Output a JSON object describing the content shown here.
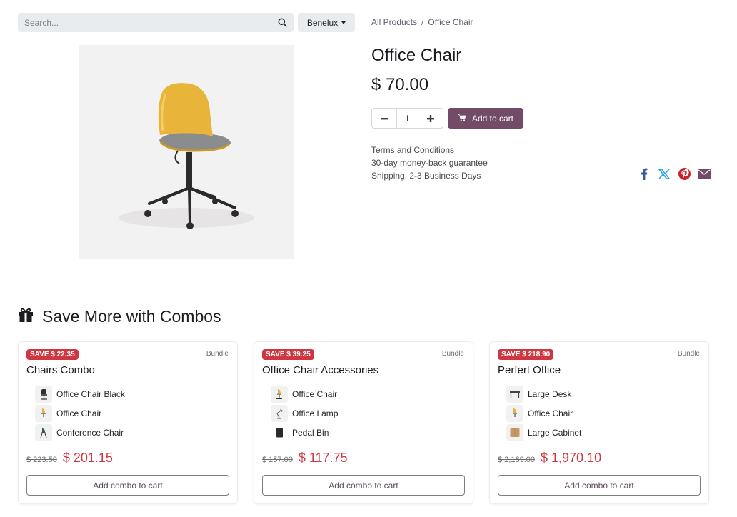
{
  "search": {
    "placeholder": "Search..."
  },
  "pricelist": {
    "label": "Benelux"
  },
  "breadcrumb": {
    "all_products": "All Products",
    "separator": "/",
    "current": "Office Chair"
  },
  "product": {
    "title": "Office Chair",
    "price": "$ 70.00",
    "quantity": "1",
    "add_to_cart": "Add to cart",
    "terms": "Terms and Conditions",
    "guarantee": "30-day money-back guarantee",
    "shipping": "Shipping: 2-3 Business Days"
  },
  "share_icons": [
    "facebook-icon",
    "x-twitter-icon",
    "pinterest-icon",
    "email-icon"
  ],
  "combos": {
    "heading": "Save More with Combos",
    "cards": [
      {
        "save": "SAVE $ 22.35",
        "bundle": "Bundle",
        "name": "Chairs Combo",
        "items": [
          "Office Chair Black",
          "Office Chair",
          "Conference Chair"
        ],
        "old_price": "$ 223.50",
        "new_price": "$ 201.15",
        "button": "Add combo to cart"
      },
      {
        "save": "SAVE $ 39.25",
        "bundle": "Bundle",
        "name": "Office Chair Accessories",
        "items": [
          "Office Chair",
          "Office Lamp",
          "Pedal Bin"
        ],
        "old_price": "$ 157.00",
        "new_price": "$ 117.75",
        "button": "Add combo to cart"
      },
      {
        "save": "SAVE $ 218.90",
        "bundle": "Bundle",
        "name": "Perfert Office",
        "items": [
          "Large Desk",
          "Office Chair",
          "Large Cabinet"
        ],
        "old_price": "$ 2,189.00",
        "new_price": "$ 1,970.10",
        "button": "Add combo to cart"
      }
    ]
  },
  "colors": {
    "brand": "#714b67",
    "sale": "#d0363f",
    "facebook": "#3b5998",
    "x": "#1da1f2",
    "pinterest": "#c8232c",
    "email": "#714b67"
  }
}
